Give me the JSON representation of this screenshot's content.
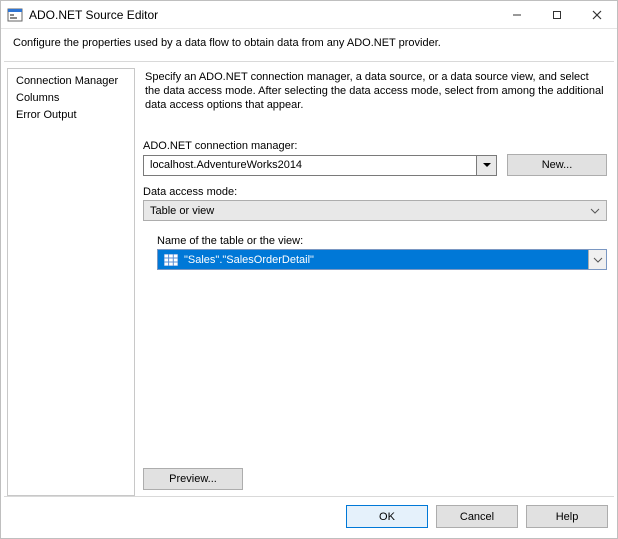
{
  "window": {
    "title": "ADO.NET Source Editor"
  },
  "subhead": "Configure the properties used by a data flow to obtain data from any ADO.NET provider.",
  "sidebar": {
    "items": [
      {
        "label": "Connection Manager"
      },
      {
        "label": "Columns"
      },
      {
        "label": "Error Output"
      }
    ]
  },
  "main": {
    "intro": "Specify an ADO.NET connection manager, a data source, or a data source view, and select the data access mode. After selecting the data access mode, select from among the additional data access options that appear.",
    "conn_label": "ADO.NET connection manager:",
    "conn_value": "localhost.AdventureWorks2014",
    "new_label": "New...",
    "mode_label": "Data access mode:",
    "mode_value": "Table or view",
    "table_label": "Name of the table or the view:",
    "table_value": "\"Sales\".\"SalesOrderDetail\"",
    "preview_label": "Preview..."
  },
  "footer": {
    "ok": "OK",
    "cancel": "Cancel",
    "help": "Help"
  }
}
